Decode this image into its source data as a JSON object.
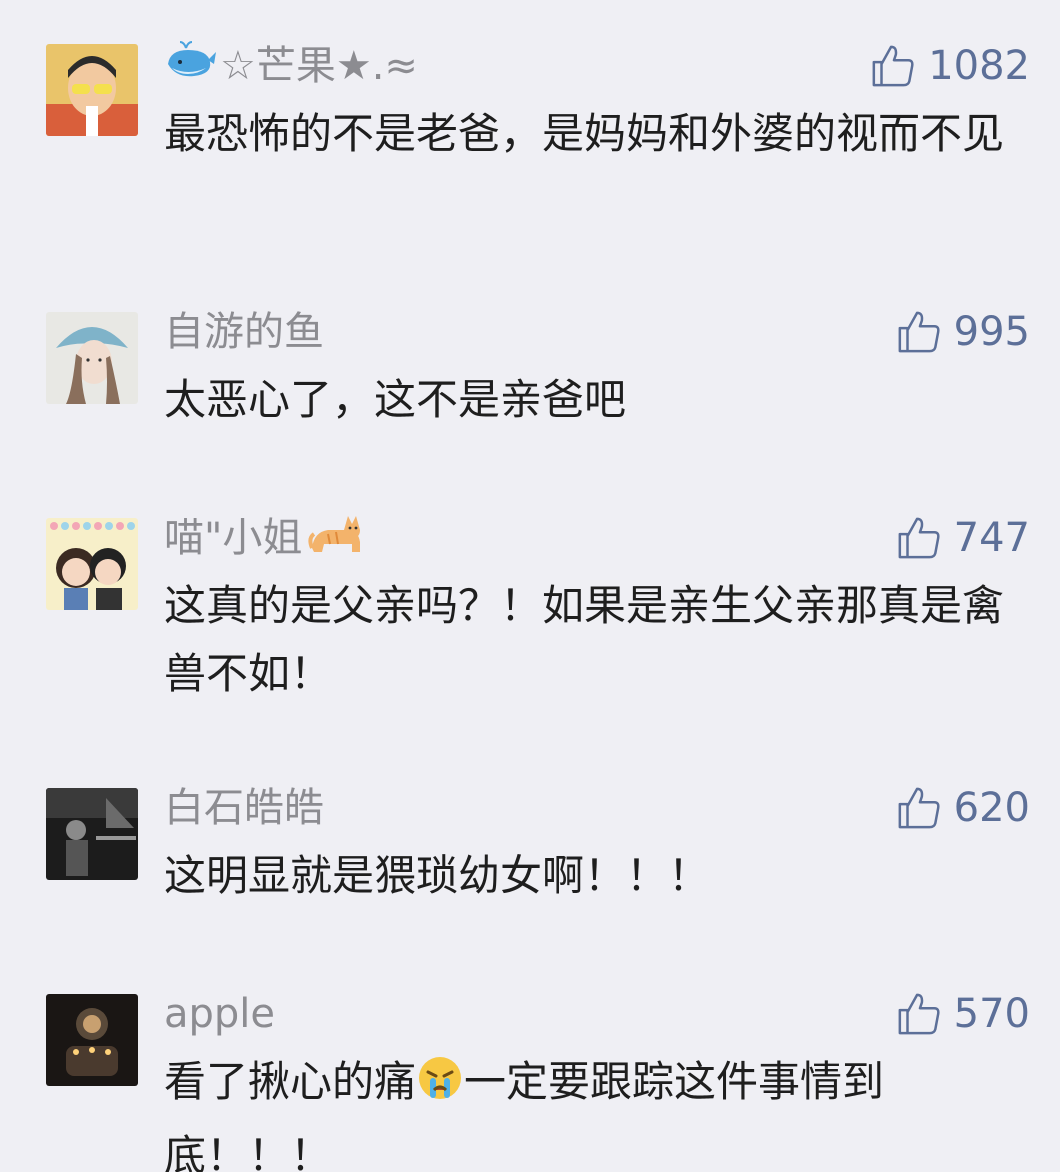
{
  "comments": [
    {
      "user": {
        "name": "☆芒果★.≈",
        "leading_icon": "whale-emoji-icon",
        "avatar": "boy-with-sunglasses-avatar"
      },
      "likes": "1082",
      "text": "最恐怖的不是老爸，是妈妈和外婆的视而不见"
    },
    {
      "user": {
        "name": "自游的鱼",
        "avatar": "illustrated-girl-avatar"
      },
      "likes": "995",
      "text": "太恶心了，这不是亲爸吧"
    },
    {
      "user": {
        "name": "喵\"小姐",
        "trailing_icon": "cat-emoji-icon",
        "avatar": "cartoon-couple-avatar"
      },
      "likes": "747",
      "text": "这真的是父亲吗？！如果是亲生父亲那真是禽兽不如！"
    },
    {
      "user": {
        "name": "白石皓皓",
        "avatar": "dark-photo-avatar"
      },
      "likes": "620",
      "text": "这明显就是猥琐幼女啊！！！"
    },
    {
      "user": {
        "name": "apple",
        "avatar": "candle-photo-avatar"
      },
      "likes": "570",
      "text_before_emoji": "看了揪心的痛",
      "inline_icon": "crying-face-emoji-icon",
      "text_after_emoji": "一定要跟踪这件事情到底！！！"
    }
  ],
  "colors": {
    "background": "#efeff4",
    "name": "#8c8c91",
    "like": "#5c6f98",
    "text": "#1e1e1e"
  }
}
